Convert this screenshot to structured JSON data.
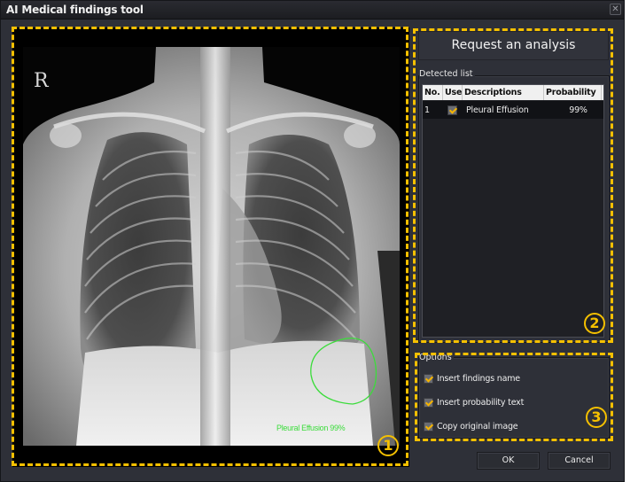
{
  "window": {
    "title": "AI Medical findings tool",
    "close_icon": "close-icon"
  },
  "image_view": {
    "side_marker": "R",
    "finding_overlay": {
      "label": "Pleural Effusion 99%",
      "outline_color": "#3cdc3c"
    },
    "callout_number": "1"
  },
  "analysis": {
    "request_button_label": "Request an analysis"
  },
  "detected_list": {
    "group_label": "Detected list",
    "columns": [
      "No.",
      "Use",
      "Descriptions",
      "Probability"
    ],
    "rows": [
      {
        "no": "1",
        "use": true,
        "description": "Pleural Effusion",
        "probability": "99%"
      }
    ],
    "callout_number": "2"
  },
  "options": {
    "group_label": "Options",
    "items": [
      {
        "label": "Insert findings name",
        "checked": true
      },
      {
        "label": "Insert probability text",
        "checked": true
      },
      {
        "label": "Copy original image",
        "checked": true
      }
    ],
    "callout_number": "3"
  },
  "footer": {
    "ok_label": "OK",
    "cancel_label": "Cancel"
  },
  "colors": {
    "callout_accent": "#f5c000",
    "checkmark": "#f5b400",
    "finding_outline": "#3cdc3c"
  }
}
